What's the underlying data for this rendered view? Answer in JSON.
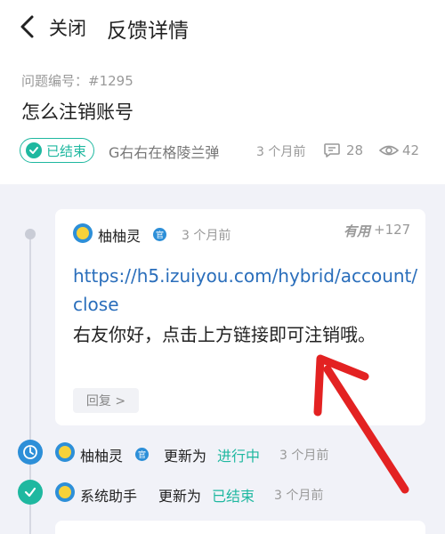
{
  "header": {
    "close_label": "关闭",
    "title": "反馈详情"
  },
  "issue": {
    "number_label": "问题编号：#1295",
    "title": "怎么注销账号",
    "status": "已结束",
    "author": "G右右在格陵兰弹",
    "time": "3 个月前",
    "comment_count": "28",
    "view_count": "42"
  },
  "comment": {
    "name": "柚柚灵",
    "official_badge": "官",
    "time": "3 个月前",
    "useful_label": "有用",
    "useful_count": "+127",
    "link": "https://h5.izuiyou.com/hybrid/account/close",
    "text": "右友你好，点击上方链接即可注销哦。",
    "reply_label": "回复 >"
  },
  "events": [
    {
      "name": "柚柚灵",
      "official_badge": "官",
      "action": "更新为",
      "status": "进行中",
      "time": "3 个月前"
    },
    {
      "name": "系统助手",
      "action": "更新为",
      "status": "已结束",
      "time": "3 个月前"
    }
  ],
  "colors": {
    "accent_teal": "#1fb8a0",
    "accent_blue": "#2d8fd8",
    "link": "#2a6ebb",
    "annotation_arrow": "#e32222"
  },
  "icons": {
    "back": "chevron-left-icon",
    "status": "check-circle-icon",
    "comments": "comment-bubble-icon",
    "views": "eye-icon",
    "in_progress": "clock-icon",
    "done": "check-icon"
  }
}
